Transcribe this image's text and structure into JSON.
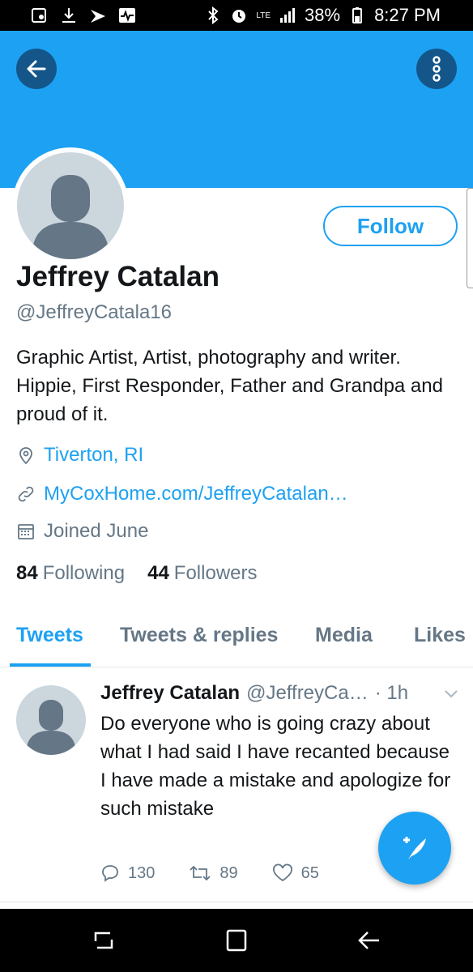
{
  "status_bar": {
    "battery": "38%",
    "time": "8:27 PM",
    "network": "LTE"
  },
  "profile": {
    "name": "Jeffrey Catalan",
    "handle": "@JeffreyCatala16",
    "bio": "Graphic Artist, Artist, photography and writer. Hippie, First Responder, Father and Grandpa and proud of it.",
    "location": "Tiverton, RI",
    "website": "MyCoxHome.com/JeffreyCatalan…",
    "joined": "Joined June",
    "following_count": "84",
    "following_label": "Following",
    "followers_count": "44",
    "followers_label": "Followers",
    "follow_button": "Follow"
  },
  "tabs": [
    {
      "label": "Tweets",
      "active": true
    },
    {
      "label": "Tweets & replies",
      "active": false
    },
    {
      "label": "Media",
      "active": false
    },
    {
      "label": "Likes",
      "active": false
    }
  ],
  "tweet": {
    "name": "Jeffrey Catalan",
    "handle": "@JeffreyCa…",
    "time": "· 1h",
    "text": "Do everyone who is going crazy about what I had said I have recanted because I have made a mistake and apologize for such mistake",
    "replies": "130",
    "retweets": "89",
    "likes": "65"
  },
  "colors": {
    "brand": "#1da1f2",
    "banner": "#1da1f2",
    "header_button": "#14568a",
    "secondary_text": "#657786"
  },
  "icons": [
    "back-arrow-icon",
    "more-vertical-icon",
    "location-pin-icon",
    "link-icon",
    "calendar-icon",
    "reply-icon",
    "retweet-icon",
    "heart-icon",
    "compose-icon",
    "chevron-down-icon"
  ]
}
